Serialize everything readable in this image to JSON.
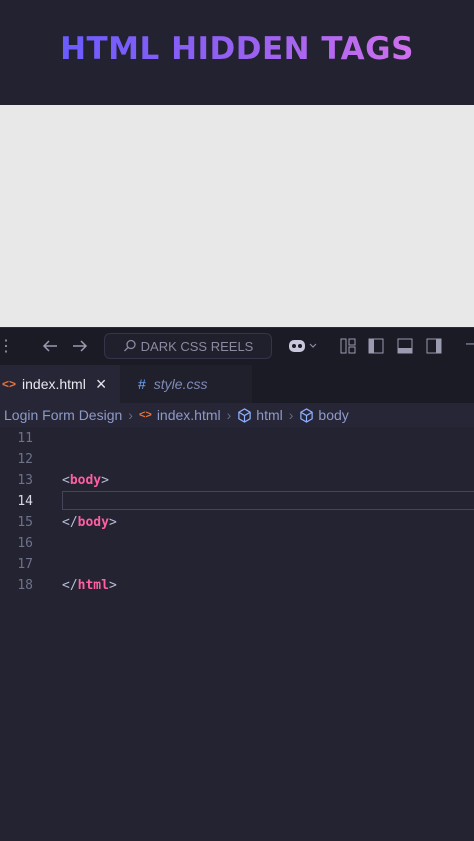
{
  "banner": {
    "title": "HTML HIDDEN TAGS"
  },
  "titlebar": {
    "search_text": "DARK CSS REELS"
  },
  "tabs": [
    {
      "label": "index.html",
      "icon": "html-file-icon",
      "close": "×"
    },
    {
      "label": "style.css",
      "icon": "css-hash-icon",
      "prefix": "#"
    }
  ],
  "breadcrumb": {
    "folder": "Login Form Design",
    "file": "index.html",
    "html": "html",
    "body": "body"
  },
  "editor": {
    "current_line": 14,
    "lines": [
      {
        "num": "11",
        "open": "",
        "tag": "",
        "close": ""
      },
      {
        "num": "12",
        "open": "",
        "tag": "",
        "close": ""
      },
      {
        "num": "13",
        "open": "<",
        "tag": "body",
        "close": ">"
      },
      {
        "num": "14",
        "open": "",
        "tag": "",
        "close": ""
      },
      {
        "num": "15",
        "open": "</",
        "tag": "body",
        "close": ">"
      },
      {
        "num": "16",
        "open": "",
        "tag": "",
        "close": ""
      },
      {
        "num": "17",
        "open": "",
        "tag": "",
        "close": ""
      },
      {
        "num": "18",
        "open": "</",
        "tag": "html",
        "close": ">"
      }
    ]
  },
  "colors": {
    "accent_tag": "#ff5fa2",
    "title_gradient_start": "#6a5cff",
    "title_gradient_end": "#d070ee"
  }
}
